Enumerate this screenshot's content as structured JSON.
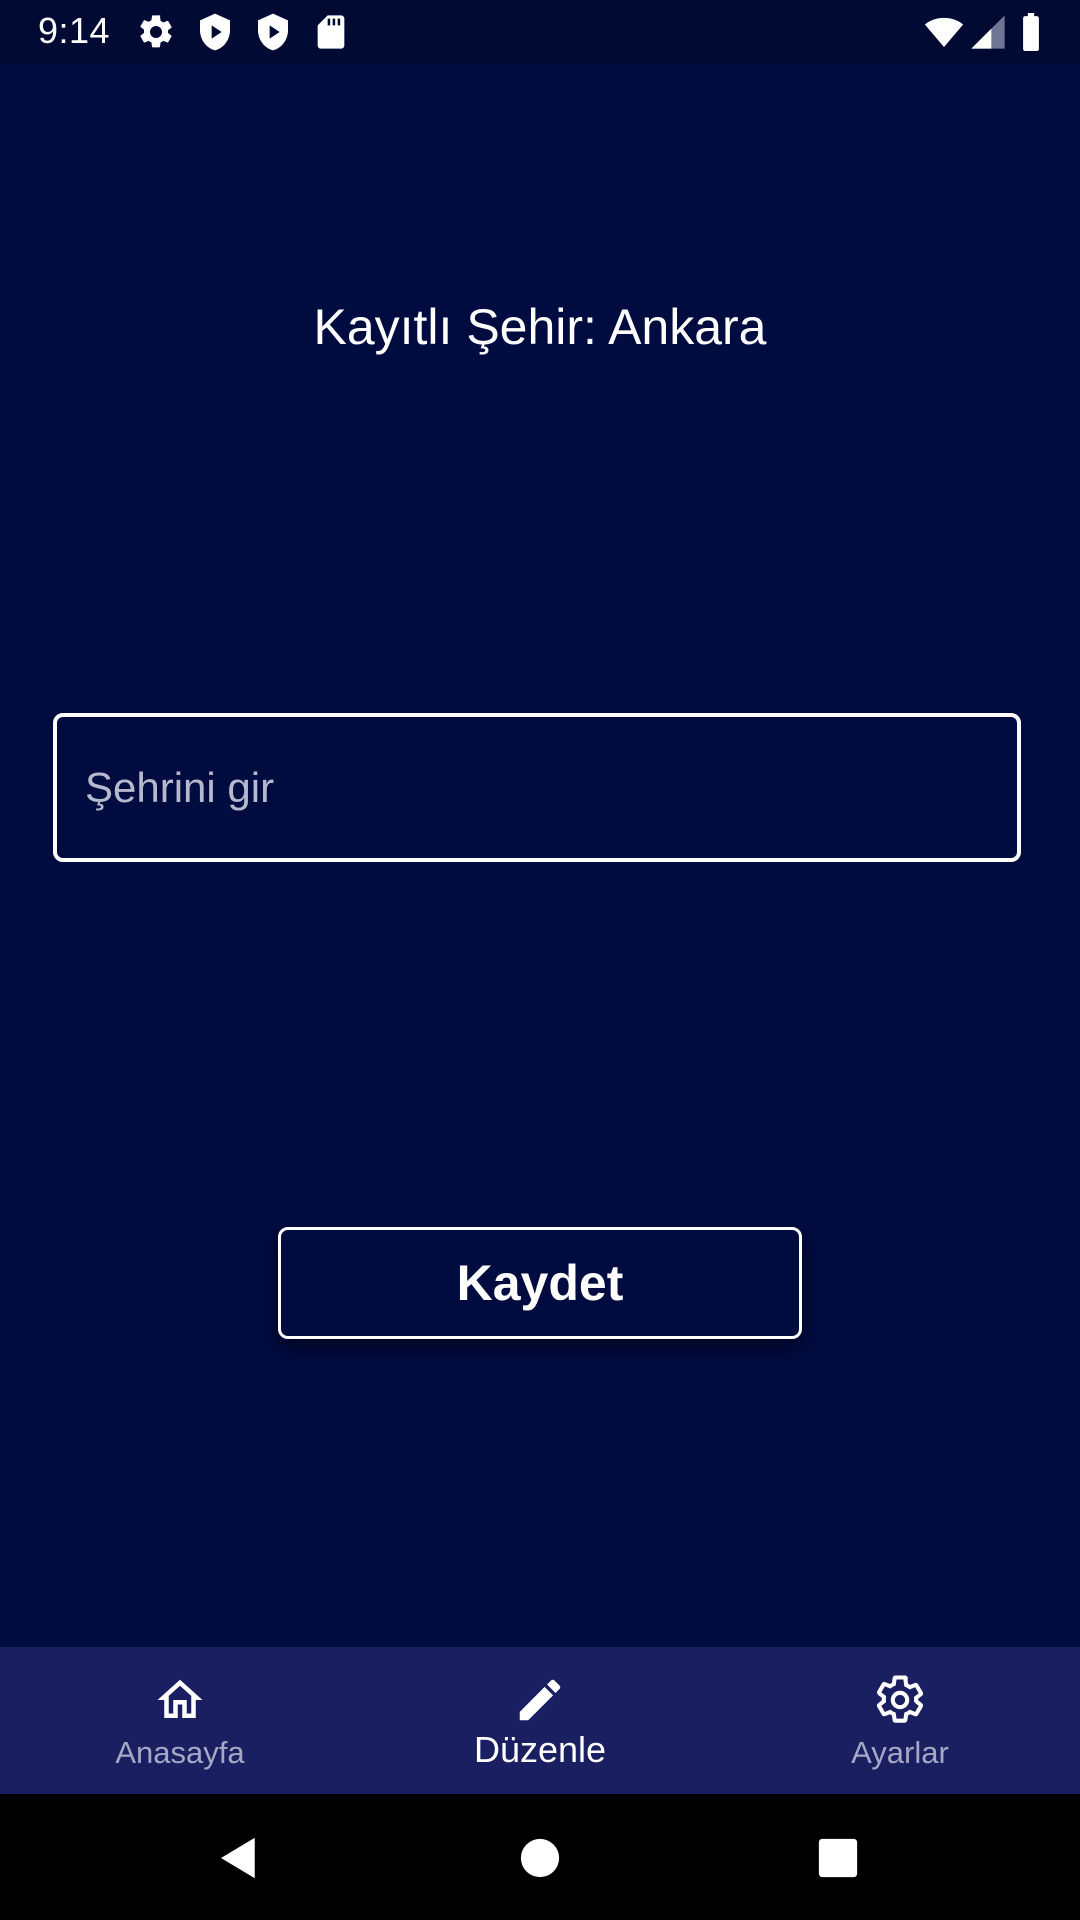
{
  "status_bar": {
    "time": "9:14",
    "icons": [
      "gear-icon",
      "shield-play-icon",
      "shield-play-icon",
      "sd-card-icon",
      "wifi-icon",
      "signal-icon",
      "battery-icon"
    ]
  },
  "main": {
    "saved_city_text": "Kayıtlı Şehir: Ankara",
    "city_input": {
      "value": "",
      "placeholder": "Şehrini gir"
    },
    "save_label": "Kaydet"
  },
  "bottom_nav": {
    "items": [
      {
        "label": "Anasayfa",
        "icon": "home-icon",
        "active": false
      },
      {
        "label": "Düzenle",
        "icon": "pencil-icon",
        "active": true
      },
      {
        "label": "Ayarlar",
        "icon": "gear-icon",
        "active": false
      }
    ]
  },
  "system_nav": {
    "buttons": [
      "back-icon",
      "home-circle-icon",
      "recents-icon"
    ]
  },
  "colors": {
    "background": "#000B3F",
    "status_bar": "#000A33",
    "bottom_nav": "#1A1F62",
    "inactive_label": "#A5A8C4",
    "text": "#FFFFFF"
  }
}
